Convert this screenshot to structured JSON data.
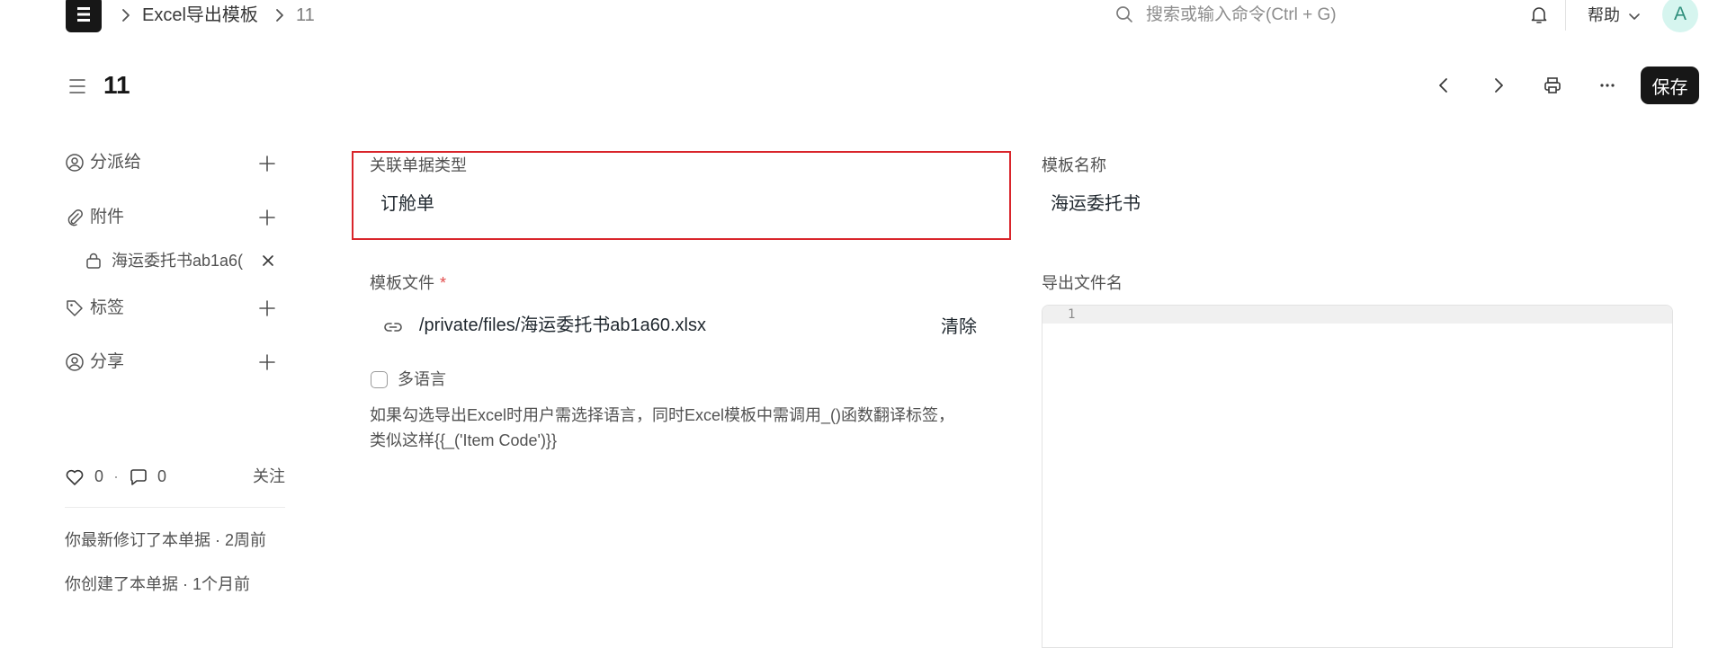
{
  "navbar": {
    "breadcrumbs": [
      "Excel导出模板",
      "11"
    ],
    "search_placeholder": "搜索或输入命令(Ctrl + G)",
    "help_label": "帮助",
    "avatar_initial": "A",
    "icons": [
      "app-logo",
      "chevron-right-icon",
      "search-icon",
      "bell-icon",
      "chevron-down-icon"
    ]
  },
  "header": {
    "title": "11",
    "save_label": "保存",
    "icons": [
      "menu-icon",
      "prev-icon",
      "next-icon",
      "print-icon",
      "more-icon"
    ]
  },
  "sidebar": {
    "assign_label": "分派给",
    "attachments_label": "附件",
    "attachment_file": "海运委托书ab1a6(",
    "tags_label": "标签",
    "share_label": "分享",
    "like_count": "0",
    "dot": "·",
    "comment_count": "0",
    "follow_label": "关注",
    "activity": [
      "你最新修订了本单据 · 2周前",
      "你创建了本单据 · 1个月前"
    ]
  },
  "form": {
    "ref_doctype_label": "关联单据类型",
    "ref_doctype_value": "订舱单",
    "template_name_label": "模板名称",
    "template_name_value": "海运委托书",
    "template_file_label": "模板文件",
    "required_mark": "*",
    "template_file_value": "/private/files/海运委托书ab1a60.xlsx",
    "clear_label": "清除",
    "export_filename_label": "导出文件名",
    "code_line_number": "1",
    "multilang_label": "多语言",
    "multilang_checked": false,
    "multilang_desc_line1": "如果勾选导出Excel时用户需选择语言，同时Excel模板中需调用_()函数翻译标签，",
    "multilang_desc_line2": "类似这样{{_('Item Code')}}"
  },
  "colors": {
    "highlight": "#d9252b",
    "primary_button": "#171717",
    "avatar_bg": "#d6f5ef"
  }
}
